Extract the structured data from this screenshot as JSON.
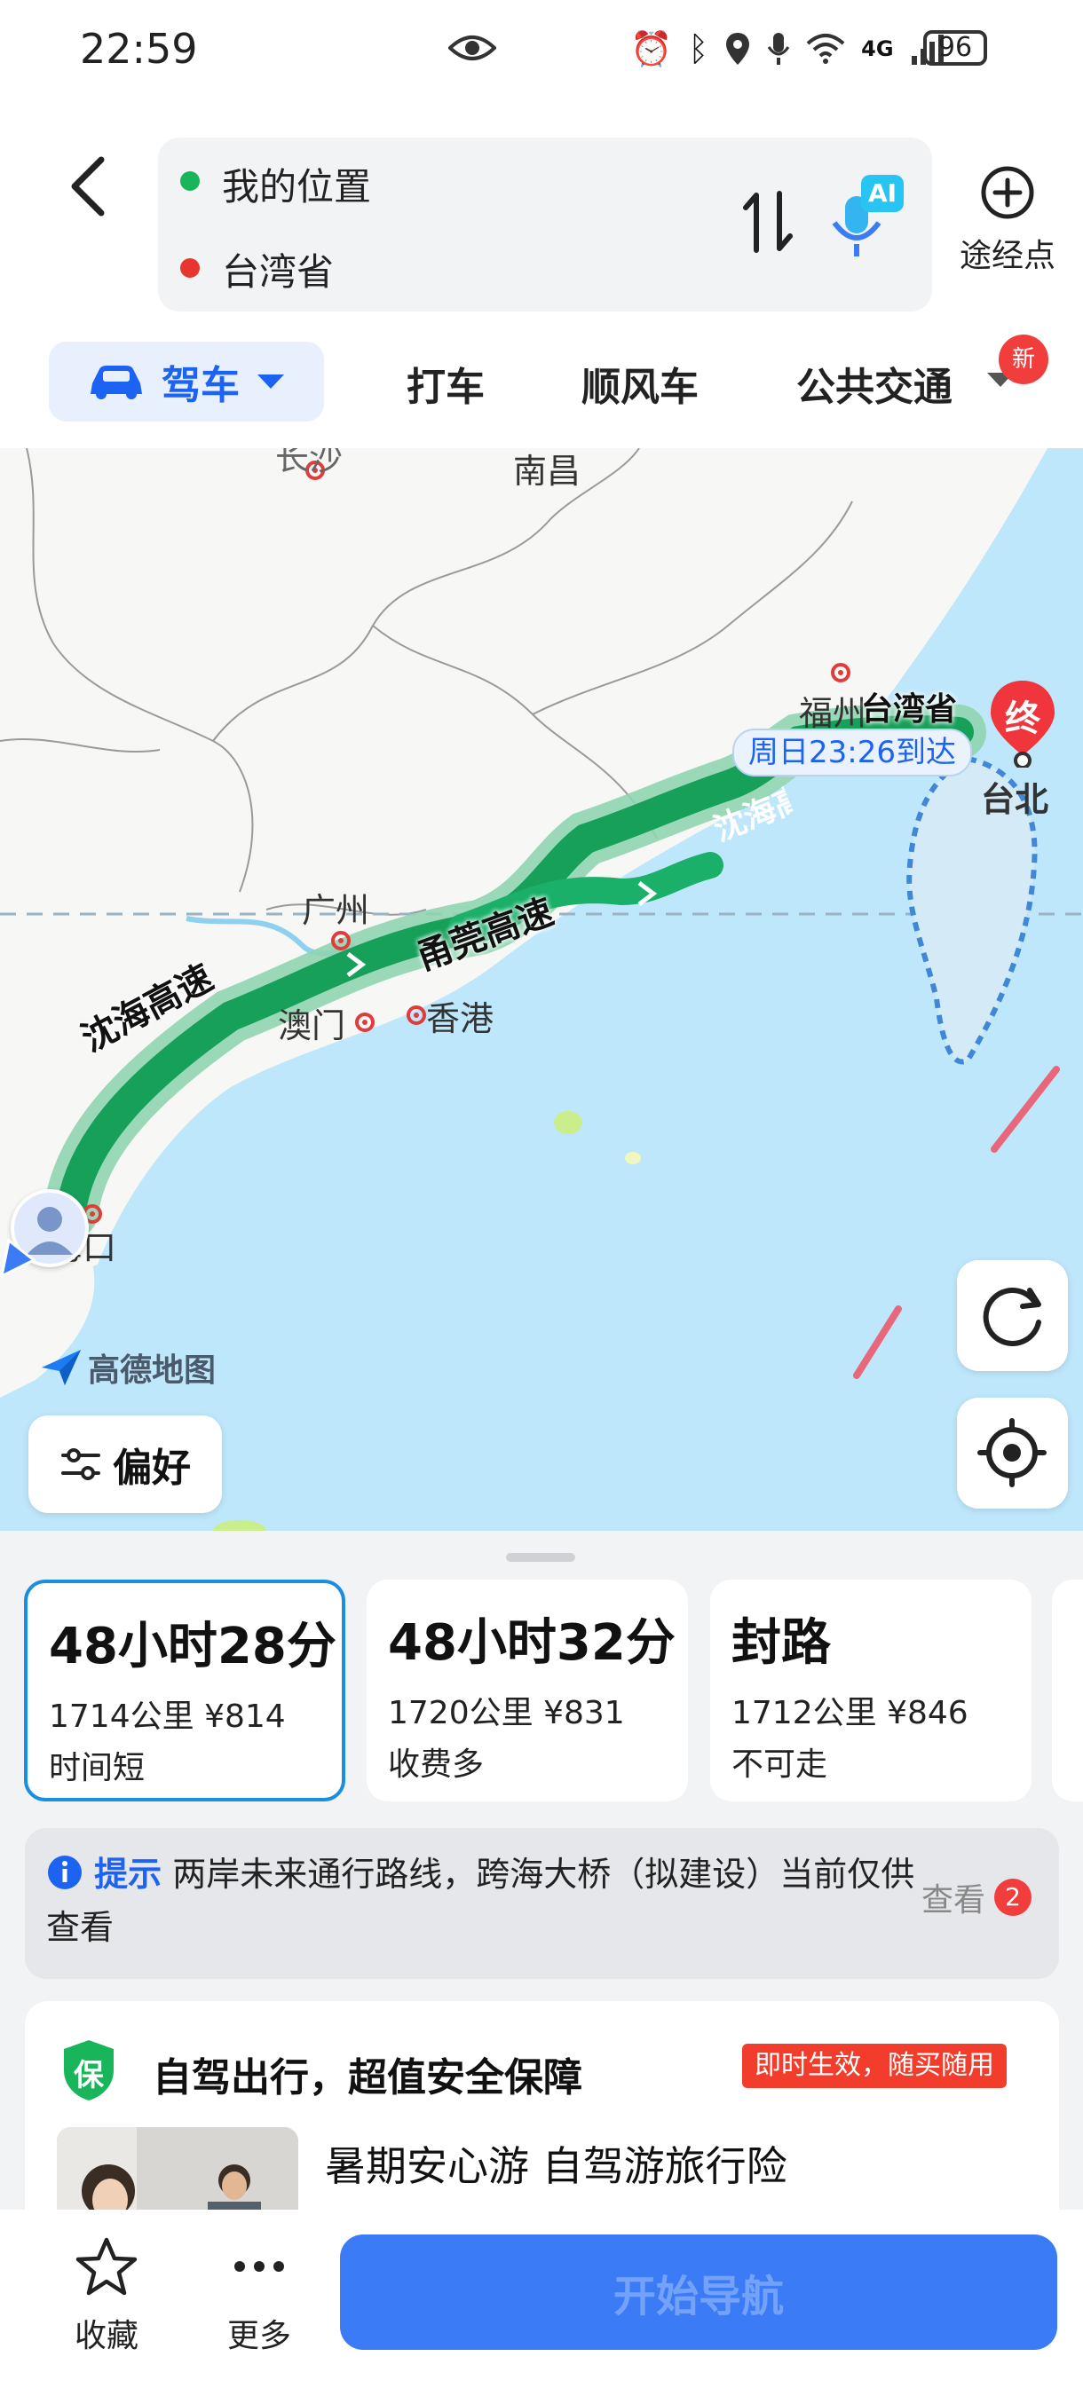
{
  "status_bar": {
    "time": "22:59",
    "network": "4G",
    "battery": "96"
  },
  "header": {
    "origin": "我的位置",
    "destination": "台湾省",
    "waypoint_label": "途经点",
    "ai_badge": "AI"
  },
  "modes": {
    "active": "驾车",
    "tabs": [
      "打车",
      "顺风车",
      "公共交通"
    ],
    "new_badge": "新"
  },
  "map": {
    "cities": [
      "长沙",
      "南昌",
      "福州",
      "广州",
      "澳门",
      "香港",
      "海口",
      "台北"
    ],
    "dest_name": "台湾省",
    "end_marker": "终",
    "arrival": "周日23:26到达",
    "roads": [
      "沈海高速",
      "甬莞高速",
      "沈海高速"
    ],
    "brand": "高德地图",
    "pref_label": "偏好"
  },
  "routes": [
    {
      "duration": "48小时28分",
      "distance": "1714公里",
      "cost": "¥814",
      "tag": "时间短",
      "selected": true
    },
    {
      "duration": "48小时32分",
      "distance": "1720公里",
      "cost": "¥831",
      "tag": "收费多",
      "selected": false
    },
    {
      "duration": "封路",
      "distance": "1712公里",
      "cost": "¥846",
      "tag": "不可走",
      "selected": false
    }
  ],
  "tip": {
    "title": "提示",
    "text": "两岸未来通行路线，跨海大桥（拟建设）当前仅供查看",
    "action": "查看",
    "count": "2"
  },
  "insurance": {
    "badge": "保",
    "title": "自驾出行，超值安全保障",
    "promo": "即时生效，随买随用",
    "product": "暑期安心游 自驾游旅行险"
  },
  "bottom": {
    "favorite": "收藏",
    "more": "更多",
    "start": "开始导航"
  }
}
